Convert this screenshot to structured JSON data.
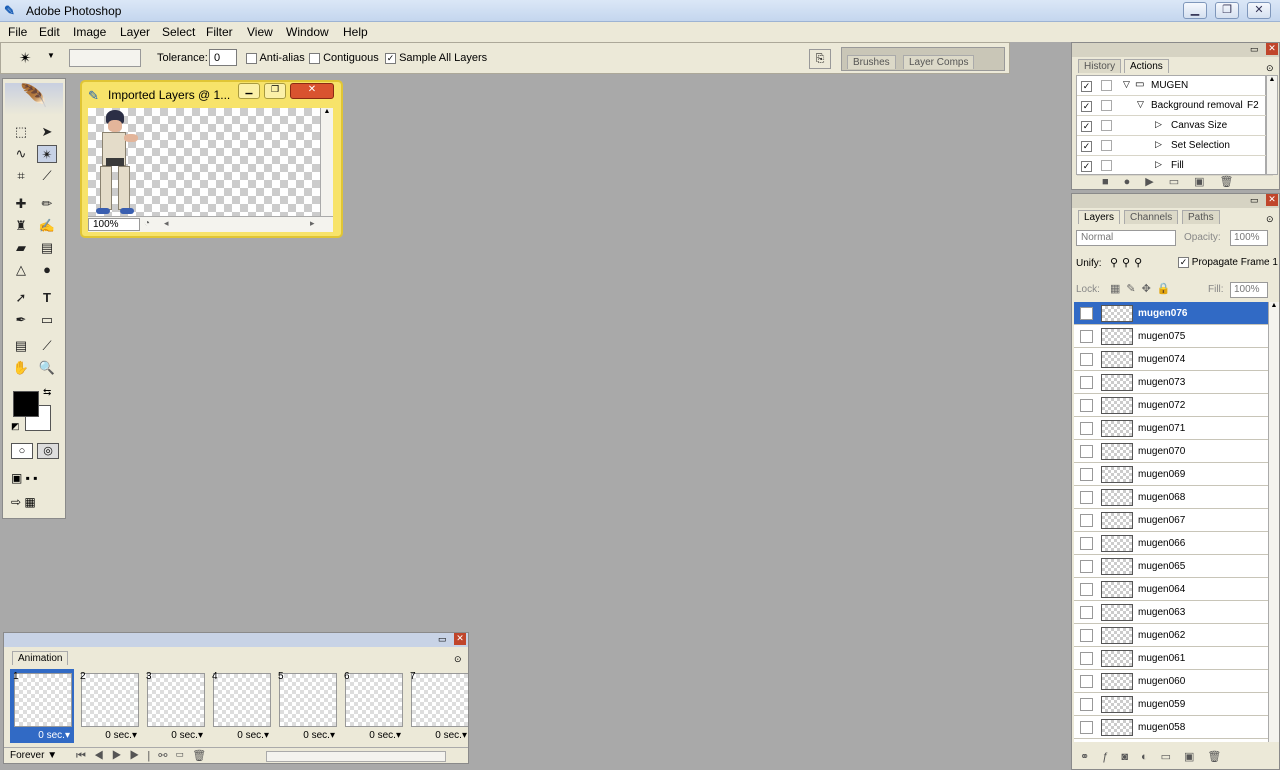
{
  "app": {
    "title": "Adobe Photoshop"
  },
  "menu": [
    "File",
    "Edit",
    "Image",
    "Layer",
    "Select",
    "Filter",
    "View",
    "Window",
    "Help"
  ],
  "options": {
    "tolerance_label": "Tolerance:",
    "tolerance_value": "0",
    "antialias_label": "Anti-alias",
    "contiguous_label": "Contiguous",
    "sample_all_label": "Sample All Layers",
    "well_tabs": [
      "Brushes",
      "Layer Comps"
    ]
  },
  "document": {
    "title": "Imported Layers @ 1...",
    "zoom": "100%"
  },
  "history_panel": {
    "tabs": [
      "History",
      "Actions"
    ],
    "rows": [
      {
        "label": "MUGEN",
        "indent": 0,
        "shortcut": ""
      },
      {
        "label": "Background removal",
        "indent": 1,
        "shortcut": "F2"
      },
      {
        "label": "Canvas Size",
        "indent": 2,
        "shortcut": ""
      },
      {
        "label": "Set Selection",
        "indent": 2,
        "shortcut": ""
      },
      {
        "label": "Fill",
        "indent": 2,
        "shortcut": ""
      }
    ]
  },
  "layers_panel": {
    "tabs": [
      "Layers",
      "Channels",
      "Paths"
    ],
    "blend_mode": "Normal",
    "opacity_label": "Opacity:",
    "opacity_value": "100%",
    "unify_label": "Unify:",
    "propagate_label": "Propagate Frame 1",
    "lock_label": "Lock:",
    "fill_label": "Fill:",
    "fill_value": "100%",
    "layers": [
      "mugen076",
      "mugen075",
      "mugen074",
      "mugen073",
      "mugen072",
      "mugen071",
      "mugen070",
      "mugen069",
      "mugen068",
      "mugen067",
      "mugen066",
      "mugen065",
      "mugen064",
      "mugen063",
      "mugen062",
      "mugen061",
      "mugen060",
      "mugen059",
      "mugen058"
    ]
  },
  "animation_panel": {
    "tab": "Animation",
    "frames": [
      {
        "num": "1",
        "dur": "0 sec."
      },
      {
        "num": "2",
        "dur": "0 sec."
      },
      {
        "num": "3",
        "dur": "0 sec."
      },
      {
        "num": "4",
        "dur": "0 sec."
      },
      {
        "num": "5",
        "dur": "0 sec."
      },
      {
        "num": "6",
        "dur": "0 sec."
      },
      {
        "num": "7",
        "dur": "0 sec."
      }
    ],
    "loop": "Forever"
  },
  "colors": {
    "selection": "#316ac5",
    "foreground": "#000000",
    "background": "#ffffff"
  }
}
